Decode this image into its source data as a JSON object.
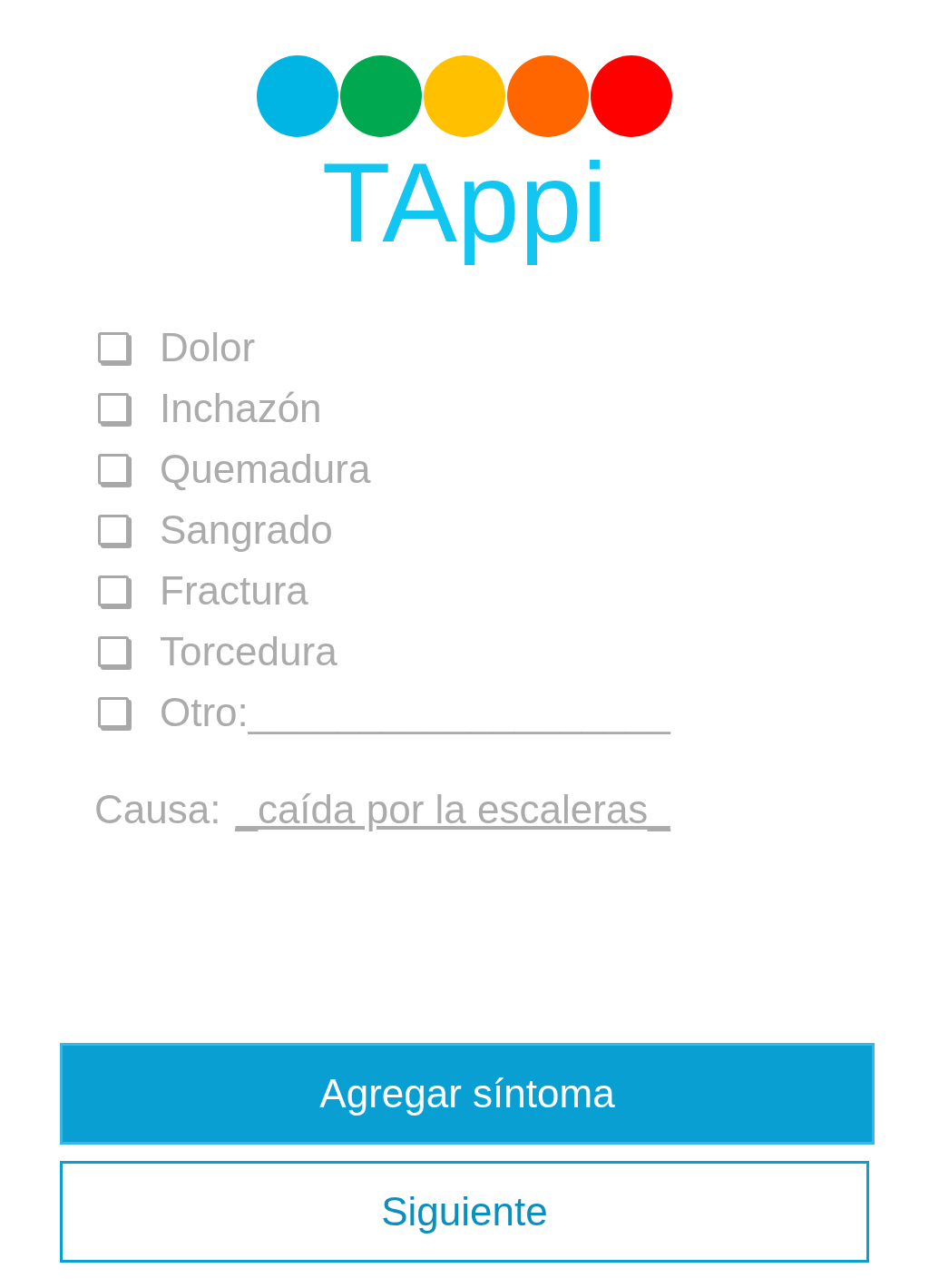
{
  "app": {
    "title": "TAppi"
  },
  "symptoms": [
    {
      "label": "Dolor",
      "checked": false
    },
    {
      "label": "Inchazón",
      "checked": false
    },
    {
      "label": "Quemadura",
      "checked": false
    },
    {
      "label": "Sangrado",
      "checked": false
    },
    {
      "label": "Fractura",
      "checked": false
    },
    {
      "label": "Torcedura",
      "checked": false
    },
    {
      "label": "Otro:___________________",
      "checked": false
    }
  ],
  "cause": {
    "label": "Causa:",
    "value": "_caída por la escaleras_"
  },
  "buttons": [
    {
      "label": "Agregar síntoma",
      "kind": "primary"
    },
    {
      "label": "Siguiente",
      "kind": "outline"
    }
  ]
}
